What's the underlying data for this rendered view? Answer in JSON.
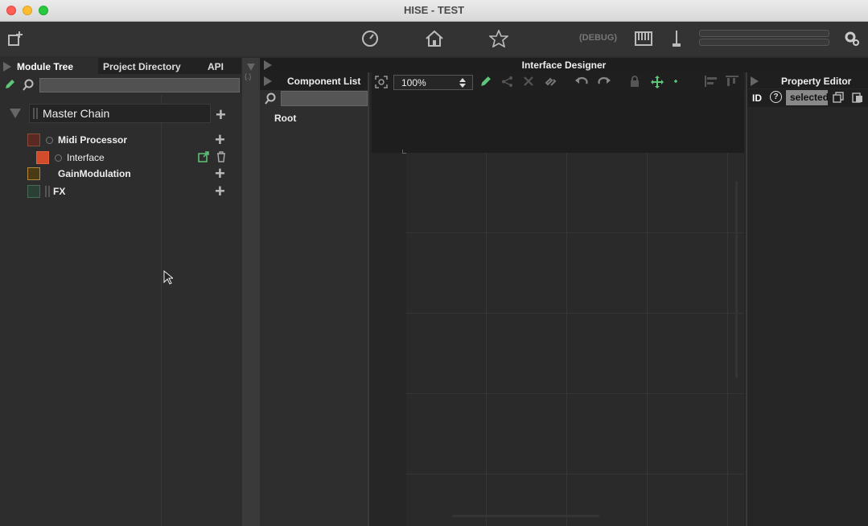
{
  "window": {
    "title": "HISE - TEST"
  },
  "toolbar": {
    "debug_label": "(DEBUG)",
    "icons": [
      "new-window-icon",
      "gauge-icon",
      "home-icon",
      "star-icon",
      "keyboard-icon",
      "tuning-fork-icon",
      "settings-icon"
    ]
  },
  "left_panel": {
    "tabs": [
      "Module Tree",
      "Project Directory",
      "API"
    ],
    "active_tab": "Module Tree",
    "search_value": "",
    "tree": {
      "master": "Master Chain",
      "items": [
        {
          "label": "Midi Processor",
          "color": "#5a2a22"
        },
        {
          "label": "Interface",
          "color": "#d24b2b"
        },
        {
          "label": "GainModulation",
          "color": "#7a5a1a"
        },
        {
          "label": "FX",
          "color": "#2a4035"
        }
      ]
    }
  },
  "designer": {
    "title": "Interface Designer",
    "component_list": {
      "title": "Component List",
      "search_value": "",
      "items": [
        "Root"
      ]
    },
    "zoom": "100%",
    "property_editor": {
      "title": "Property Editor",
      "id_label": "ID",
      "help_label": "?",
      "selection_text": "selected"
    }
  },
  "colors": {
    "accent_green": "#5fc77a",
    "background": "#2b2b2b",
    "titlebar": "#e3e3e3"
  }
}
